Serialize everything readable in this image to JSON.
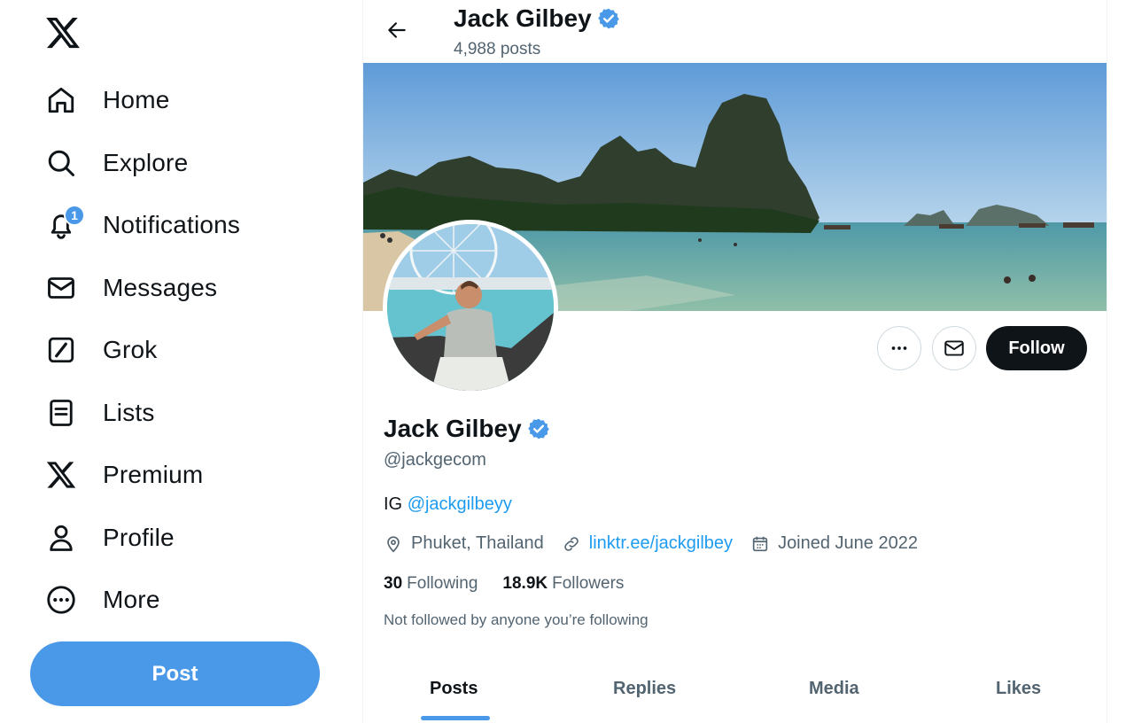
{
  "nav": {
    "items": [
      {
        "label": "Home",
        "icon": "home-icon"
      },
      {
        "label": "Explore",
        "icon": "search-icon"
      },
      {
        "label": "Notifications",
        "icon": "bell-icon",
        "badge": "1"
      },
      {
        "label": "Messages",
        "icon": "envelope-icon"
      },
      {
        "label": "Grok",
        "icon": "grok-icon"
      },
      {
        "label": "Lists",
        "icon": "list-icon"
      },
      {
        "label": "Premium",
        "icon": "x-logo-icon"
      },
      {
        "label": "Profile",
        "icon": "person-icon"
      },
      {
        "label": "More",
        "icon": "more-circle-icon"
      }
    ],
    "post_label": "Post"
  },
  "header": {
    "name": "Jack Gilbey",
    "posts": "4,988 posts"
  },
  "profile": {
    "name": "Jack Gilbey",
    "handle": "@jackgecom",
    "bio_prefix": "IG",
    "bio_mention": "@jackgilbeyy",
    "location": "Phuket, Thailand",
    "link": "linktr.ee/jackgilbey",
    "joined": "Joined June 2022",
    "following_count": "30",
    "following_label": "Following",
    "followers_count": "18.9K",
    "followers_label": "Followers",
    "not_followed": "Not followed by anyone you’re following",
    "follow_label": "Follow"
  },
  "tabs": [
    "Posts",
    "Replies",
    "Media",
    "Likes"
  ],
  "active_tab": "Posts",
  "colors": {
    "accent": "#4a99e9",
    "link": "#1d9bf0",
    "text": "#0f1419",
    "muted": "#536471"
  }
}
